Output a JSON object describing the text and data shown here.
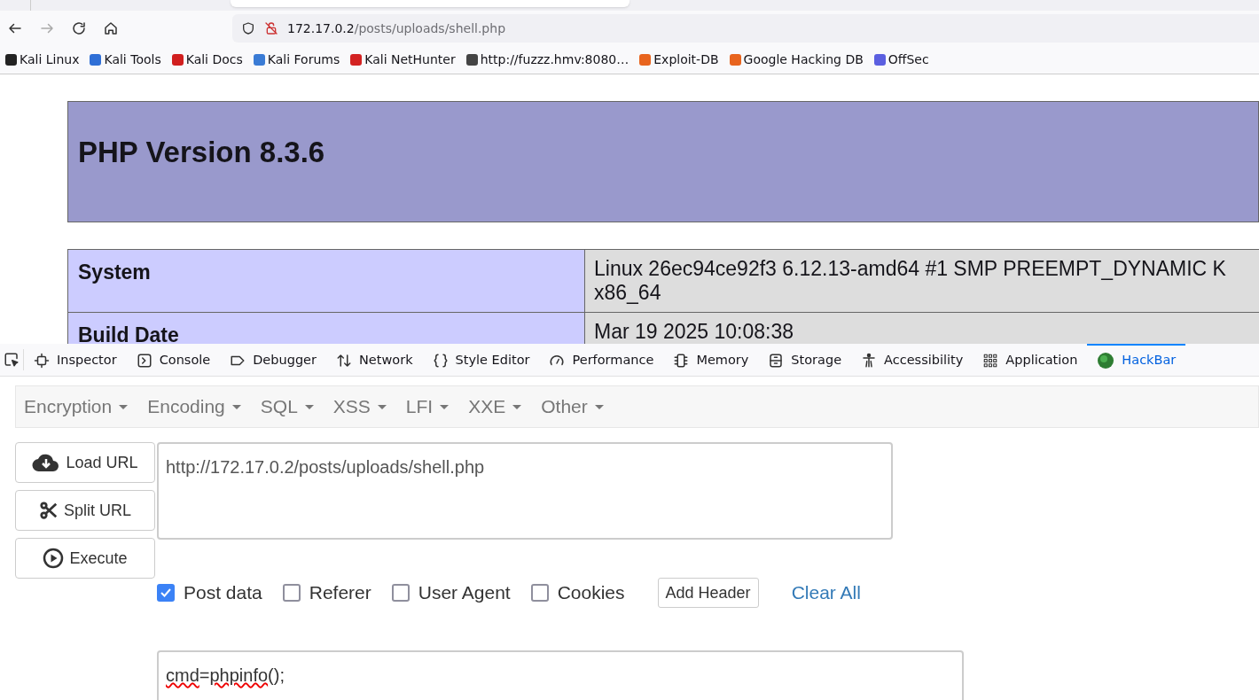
{
  "browser": {
    "url_host": "172.17.0.2",
    "url_path": "/posts/uploads/shell.php",
    "bookmarks": [
      {
        "label": "Kali Linux",
        "color": "#222222"
      },
      {
        "label": "Kali Tools",
        "color": "#2f6fd6"
      },
      {
        "label": "Kali Docs",
        "color": "#d11f1f"
      },
      {
        "label": "Kali Forums",
        "color": "#3a7bd5"
      },
      {
        "label": "Kali NetHunter",
        "color": "#d32222"
      },
      {
        "label": "http://fuzzz.hmv:8080…",
        "color": "#444444"
      },
      {
        "label": "Exploit-DB",
        "color": "#e8641e"
      },
      {
        "label": "Google Hacking DB",
        "color": "#e8641e"
      },
      {
        "label": "OffSec",
        "color": "#5b5fe0"
      }
    ]
  },
  "page": {
    "title": "PHP Version 8.3.6",
    "rows": [
      {
        "key": "System",
        "value": "Linux 26ec94ce92f3 6.12.13-amd64 #1 SMP PREEMPT_DYNAMIC K",
        "value_line2": "x86_64"
      },
      {
        "key": "Build Date",
        "value": "Mar 19 2025 10:08:38"
      }
    ]
  },
  "devtools": {
    "tabs": [
      {
        "label": "Inspector",
        "selected": false
      },
      {
        "label": "Console",
        "selected": false
      },
      {
        "label": "Debugger",
        "selected": false
      },
      {
        "label": "Network",
        "selected": false
      },
      {
        "label": "Style Editor",
        "selected": false
      },
      {
        "label": "Performance",
        "selected": false
      },
      {
        "label": "Memory",
        "selected": false
      },
      {
        "label": "Storage",
        "selected": false
      },
      {
        "label": "Accessibility",
        "selected": false
      },
      {
        "label": "Application",
        "selected": false
      },
      {
        "label": "HackBar",
        "selected": true
      }
    ]
  },
  "hackbar": {
    "menus": [
      "Encryption",
      "Encoding",
      "SQL",
      "XSS",
      "LFI",
      "XXE",
      "Other"
    ],
    "buttons": [
      "Load URL",
      "Split URL",
      "Execute"
    ],
    "url": "http://172.17.0.2/posts/uploads/shell.php",
    "options": [
      {
        "label": "Post data",
        "checked": true
      },
      {
        "label": "Referer",
        "checked": false
      },
      {
        "label": "User Agent",
        "checked": false
      },
      {
        "label": "Cookies",
        "checked": false
      }
    ],
    "add_header": "Add Header",
    "clear_all": "Clear All",
    "post_body_key": "cmd",
    "post_body_sep": "=",
    "post_body_func": "phpinfo",
    "post_body_rest": "();"
  }
}
